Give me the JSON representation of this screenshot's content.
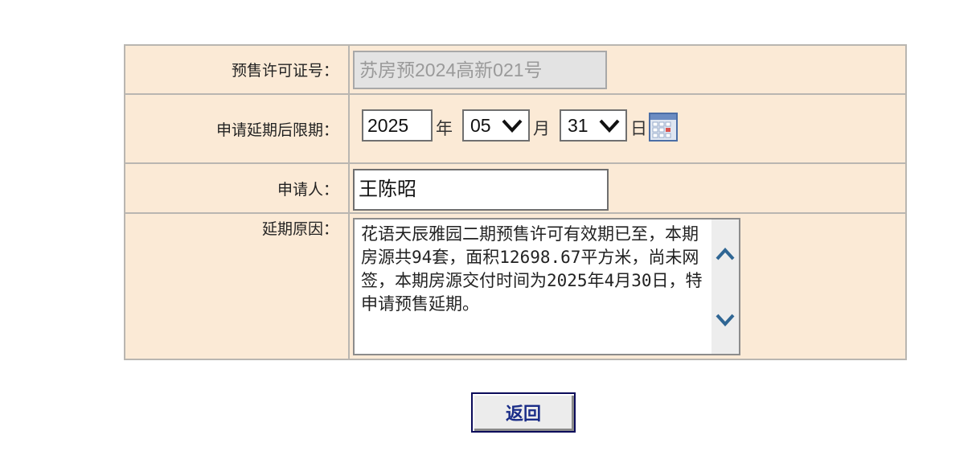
{
  "form": {
    "permit": {
      "label": "预售许可证号：",
      "value": "苏房预2024高新021号"
    },
    "extension_date": {
      "label": "申请延期后限期：",
      "year": "2025",
      "year_unit": "年",
      "month": "05",
      "month_unit": "月",
      "day": "31",
      "day_unit": "日"
    },
    "applicant": {
      "label": "申请人：",
      "value": "王陈昭"
    },
    "reason": {
      "label": "延期原因：",
      "value": "花语天辰雅园二期预售许可有效期已至，本期房源共94套，面积12698.67平方米，尚未网签，本期房源交付时间为2025年4月30日，特申请预售延期。"
    }
  },
  "buttons": {
    "back_label": "返回"
  },
  "colors": {
    "form_background": "#fbead6",
    "button_text": "#1a2d88",
    "scroll_arrow": "#2f6694"
  },
  "icons": {
    "calendar": "calendar-icon",
    "dropdown": "chevron-down-icon",
    "scroll_up": "chevron-up-icon",
    "scroll_down": "chevron-down-icon"
  }
}
